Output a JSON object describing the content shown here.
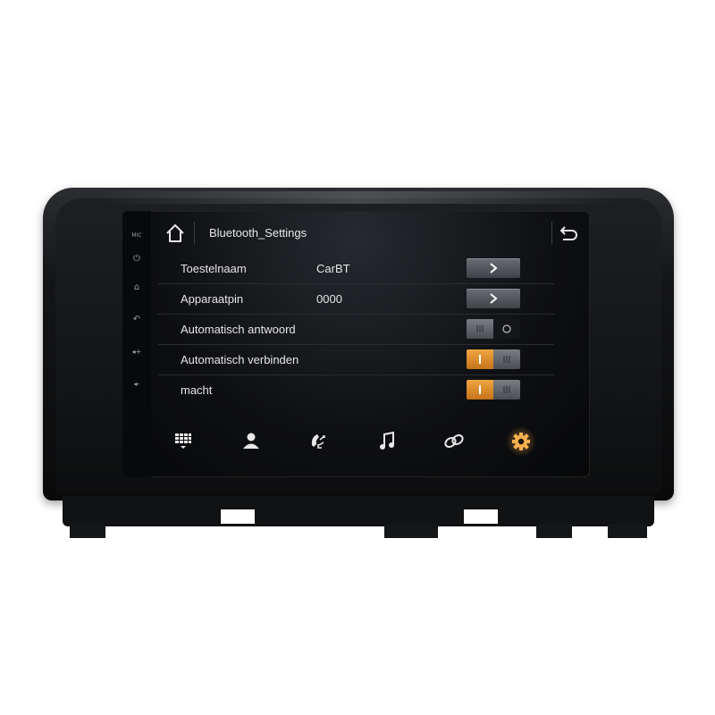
{
  "header": {
    "title": "Bluetooth_Settings"
  },
  "settings": [
    {
      "label": "Toestelnaam",
      "value": "CarBT",
      "control": "arrow"
    },
    {
      "label": "Apparaatpin",
      "value": "0000",
      "control": "arrow"
    },
    {
      "label": "Automatisch antwoord",
      "value": "",
      "control": "toggle",
      "state": "off"
    },
    {
      "label": "Automatisch verbinden",
      "value": "",
      "control": "toggle",
      "state": "on"
    },
    {
      "label": "macht",
      "value": "",
      "control": "toggle",
      "state": "on"
    }
  ],
  "bottom_nav": [
    {
      "icon": "dialpad-icon",
      "active": false
    },
    {
      "icon": "contacts-icon",
      "active": false
    },
    {
      "icon": "call-log-icon",
      "active": false
    },
    {
      "icon": "music-icon",
      "active": false
    },
    {
      "icon": "link-icon",
      "active": false
    },
    {
      "icon": "settings-gear-icon",
      "active": true
    }
  ],
  "side_keys": [
    {
      "icon": "mic-icon",
      "glyph": "MIC"
    },
    {
      "icon": "power-icon",
      "glyph": "⏻"
    },
    {
      "icon": "home-icon",
      "glyph": "⌂"
    },
    {
      "icon": "back-icon",
      "glyph": "↶"
    },
    {
      "icon": "volume-up-icon",
      "glyph": "◂+"
    },
    {
      "icon": "volume-down-icon",
      "glyph": "◂-"
    }
  ],
  "colors": {
    "accent": "#f0a542",
    "text": "#e6e6e6",
    "button": "#55585d"
  }
}
